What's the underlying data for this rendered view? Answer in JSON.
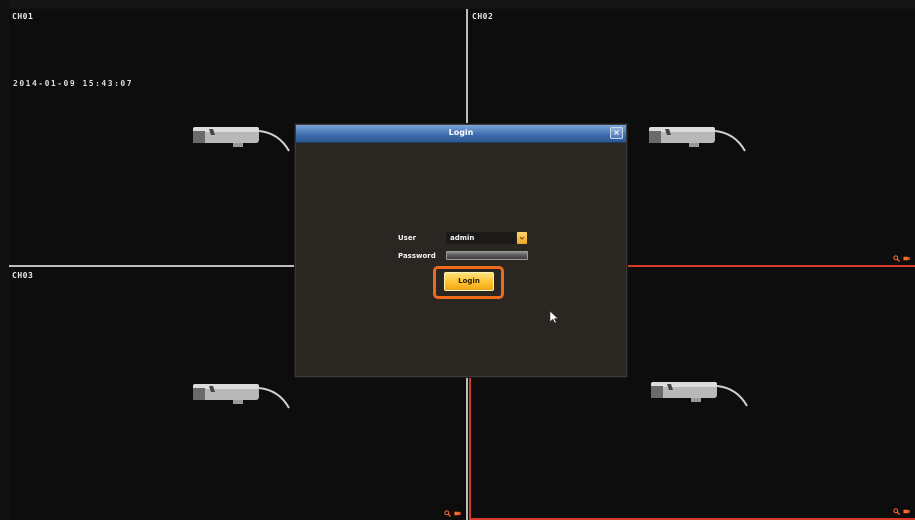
{
  "channels": [
    {
      "label": "CH01",
      "timestamp": "2014-01-09 15:43:07"
    },
    {
      "label": "CH02"
    },
    {
      "label": "CH03"
    },
    {
      "label": ""
    }
  ],
  "dialog": {
    "title": "Login",
    "close_glyph": "×",
    "user_label": "User",
    "user_value": "admin",
    "password_label": "Password",
    "password_value": "",
    "login_button": "Login"
  },
  "icons": {
    "zoom": "magnifier-icon",
    "record": "camera-record-icon",
    "cursor": "mouse-pointer-icon",
    "dropdown": "chevron-down-icon"
  },
  "colors": {
    "title_bar": "#3f6fb0",
    "highlight": "#f06a1c",
    "login_button": "#ffc02a",
    "selected_tile_border": "#d63a2a",
    "tile_divider": "#b9b9b9"
  }
}
